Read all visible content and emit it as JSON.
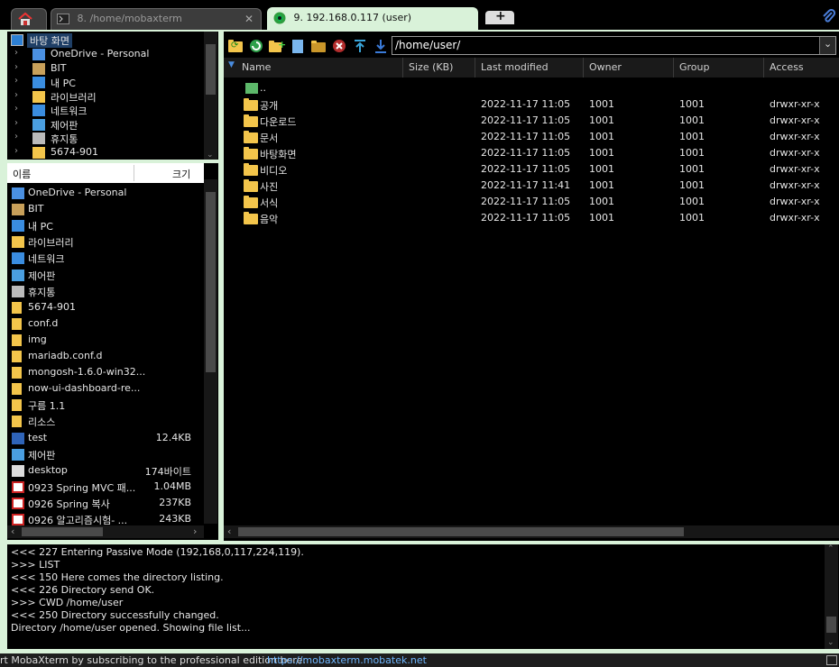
{
  "tabs": [
    {
      "label": ""
    },
    {
      "label": "8. /home/mobaxterm"
    },
    {
      "label": "9. 192.168.0.117 (user)"
    }
  ],
  "tree": {
    "root": "바탕 화면",
    "items": [
      "OneDrive - Personal",
      "BIT",
      "내 PC",
      "라이브러리",
      "네트워크",
      "제어판",
      "휴지통",
      "5674-901"
    ]
  },
  "local_list": {
    "col_name": "이름",
    "col_size": "크기",
    "rows": [
      {
        "name": "OneDrive - Personal",
        "size": ""
      },
      {
        "name": "BIT",
        "size": ""
      },
      {
        "name": "내 PC",
        "size": ""
      },
      {
        "name": "라이브러리",
        "size": ""
      },
      {
        "name": "네트워크",
        "size": ""
      },
      {
        "name": "제어판",
        "size": ""
      },
      {
        "name": "휴지통",
        "size": ""
      },
      {
        "name": "5674-901",
        "size": ""
      },
      {
        "name": "conf.d",
        "size": ""
      },
      {
        "name": "img",
        "size": ""
      },
      {
        "name": "mariadb.conf.d",
        "size": ""
      },
      {
        "name": "mongosh-1.6.0-win32...",
        "size": ""
      },
      {
        "name": "now-ui-dashboard-re...",
        "size": ""
      },
      {
        "name": "구름 1.1",
        "size": ""
      },
      {
        "name": "리소스",
        "size": ""
      },
      {
        "name": "test",
        "size": "12.4KB"
      },
      {
        "name": "제어판",
        "size": ""
      },
      {
        "name": "desktop",
        "size": "174바이트"
      },
      {
        "name": "0923 Spring MVC 패...",
        "size": "1.04MB"
      },
      {
        "name": "0926 Spring 복사",
        "size": "237KB"
      },
      {
        "name": "0926 알고리즘시험- ...",
        "size": "243KB"
      }
    ]
  },
  "remote": {
    "path": "/home/user/",
    "columns": [
      "Name",
      "Size (KB)",
      "Last modified",
      "Owner",
      "Group",
      "Access"
    ],
    "parent": "..",
    "files": [
      {
        "name": "공개",
        "modified": "2022-11-17 11:05",
        "owner": "1001",
        "group": "1001",
        "access": "drwxr-xr-x"
      },
      {
        "name": "다운로드",
        "modified": "2022-11-17 11:05",
        "owner": "1001",
        "group": "1001",
        "access": "drwxr-xr-x"
      },
      {
        "name": "문서",
        "modified": "2022-11-17 11:05",
        "owner": "1001",
        "group": "1001",
        "access": "drwxr-xr-x"
      },
      {
        "name": "바탕화면",
        "modified": "2022-11-17 11:05",
        "owner": "1001",
        "group": "1001",
        "access": "drwxr-xr-x"
      },
      {
        "name": "비디오",
        "modified": "2022-11-17 11:05",
        "owner": "1001",
        "group": "1001",
        "access": "drwxr-xr-x"
      },
      {
        "name": "사진",
        "modified": "2022-11-17 11:41",
        "owner": "1001",
        "group": "1001",
        "access": "drwxr-xr-x"
      },
      {
        "name": "서식",
        "modified": "2022-11-17 11:05",
        "owner": "1001",
        "group": "1001",
        "access": "drwxr-xr-x"
      },
      {
        "name": "음악",
        "modified": "2022-11-17 11:05",
        "owner": "1001",
        "group": "1001",
        "access": "drwxr-xr-x"
      }
    ]
  },
  "log": [
    "<<<  227 Entering Passive Mode (192,168,0,117,224,119).",
    ">>>  LIST",
    "<<<  150 Here comes the directory listing.",
    "<<<  226 Directory send OK.",
    ">>>  CWD /home/user",
    "<<<  250 Directory successfully changed.",
    "Directory /home/user opened. Showing file list..."
  ],
  "status": {
    "text": "rt MobaXterm by subscribing to the professional edition here:",
    "link": "https://mobaxterm.mobatek.net"
  },
  "colors": {
    "accent": "#d9f2d9",
    "folder": "#f3c54b",
    "link": "#6fb7ff"
  }
}
